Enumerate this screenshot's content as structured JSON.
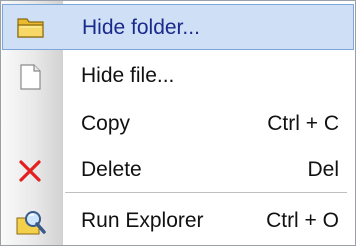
{
  "menu": {
    "items": [
      {
        "label": "Hide folder...",
        "shortcut": "",
        "icon": "folder-icon",
        "selected": true
      },
      {
        "label": "Hide file...",
        "shortcut": "",
        "icon": "file-icon",
        "selected": false
      },
      {
        "label": "Copy",
        "shortcut": "Ctrl + C",
        "icon": "",
        "selected": false
      },
      {
        "label": "Delete",
        "shortcut": "Del",
        "icon": "delete-x-icon",
        "selected": false
      },
      {
        "label": "Run Explorer",
        "shortcut": "Ctrl + O",
        "icon": "explorer-magnifier-icon",
        "selected": false
      }
    ]
  },
  "colors": {
    "selection_background": "#cfe0f6",
    "selection_border": "#7fa6d8",
    "delete_icon": "#e32020",
    "folder_icon": "#f3cf4a"
  }
}
